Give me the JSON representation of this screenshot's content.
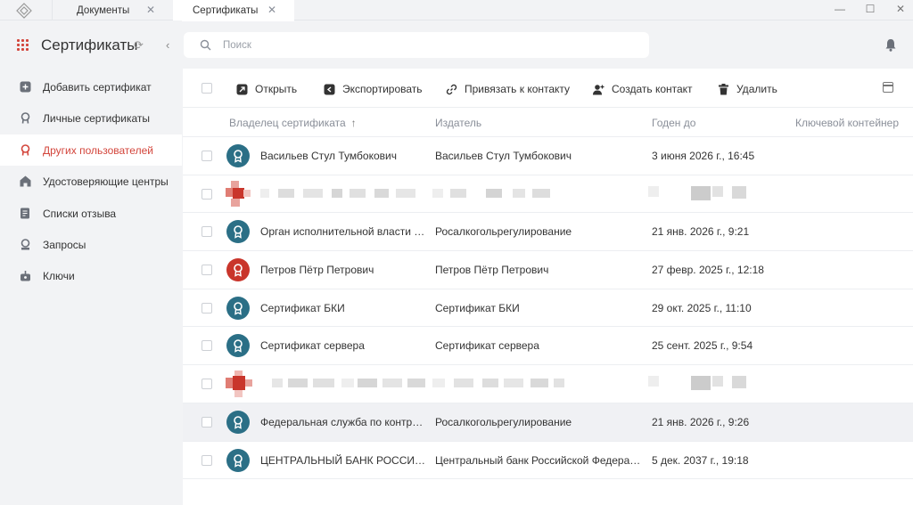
{
  "titlebar": {
    "tabs": [
      {
        "label": "Документы",
        "close": "✕"
      },
      {
        "label": "Сертификаты",
        "close": "✕"
      }
    ],
    "window_controls": {
      "minimize": "—",
      "maximize": "☐",
      "close": "✕"
    }
  },
  "sidebar": {
    "title": "Сертификаты",
    "items": [
      {
        "label": "Добавить сертификат",
        "icon": "plus-square-icon"
      },
      {
        "label": "Личные сертификаты",
        "icon": "certificate-icon"
      },
      {
        "label": "Других пользователей",
        "icon": "certificate-icon"
      },
      {
        "label": "Удостоверяющие центры",
        "icon": "house-icon"
      },
      {
        "label": "Списки отзыва",
        "icon": "revocation-list-icon"
      },
      {
        "label": "Запросы",
        "icon": "request-icon"
      },
      {
        "label": "Ключи",
        "icon": "key-icon"
      }
    ]
  },
  "search": {
    "placeholder": "Поиск",
    "value": ""
  },
  "toolbar": {
    "open": "Открыть",
    "export": "Экспортировать",
    "link_contact": "Привязать к контакту",
    "create_contact": "Создать контакт",
    "delete": "Удалить"
  },
  "table": {
    "columns": {
      "owner": "Владелец сертификата",
      "issuer": "Издатель",
      "valid_until": "Годен до",
      "key_container": "Ключевой контейнер"
    },
    "sort_indicator": "↑",
    "rows": [
      {
        "owner": "Васильев Стул Тумбокович",
        "issuer": "Васильев Стул Тумбокович",
        "valid_until": "3 июня 2026 г., 16:45",
        "avatar": "teal"
      },
      {
        "blurred": true
      },
      {
        "owner": "Орган исполнительной власти су...",
        "issuer": "Росалкогольрегулирование",
        "valid_until": "21 янв. 2026 г., 9:21",
        "avatar": "teal"
      },
      {
        "owner": "Петров Пётр Петрович",
        "issuer": "Петров Пётр Петрович",
        "valid_until": "27 февр. 2025 г., 12:18",
        "avatar": "red"
      },
      {
        "owner": "Сертификат БКИ",
        "issuer": "Сертификат БКИ",
        "valid_until": "29 окт. 2025 г., 11:10",
        "avatar": "teal"
      },
      {
        "owner": "Сертификат сервера",
        "issuer": "Сертификат сервера",
        "valid_until": "25 сент. 2025 г., 9:54",
        "avatar": "teal"
      },
      {
        "blurred": true
      },
      {
        "owner": "Федеральная служба по контрол...",
        "issuer": "Росалкогольрегулирование",
        "valid_until": "21 янв. 2026 г., 9:26",
        "avatar": "teal",
        "selected": true
      },
      {
        "owner": "ЦЕНТРАЛЬНЫЙ БАНК РОССИЙС...",
        "issuer": "Центральный банк Российской Федерации",
        "valid_until": "5 дек. 2037 г., 19:18",
        "avatar": "teal"
      }
    ]
  },
  "colors": {
    "accent": "#d3453b",
    "avatar_teal": "#2b6f86",
    "avatar_red": "#c9352b"
  }
}
